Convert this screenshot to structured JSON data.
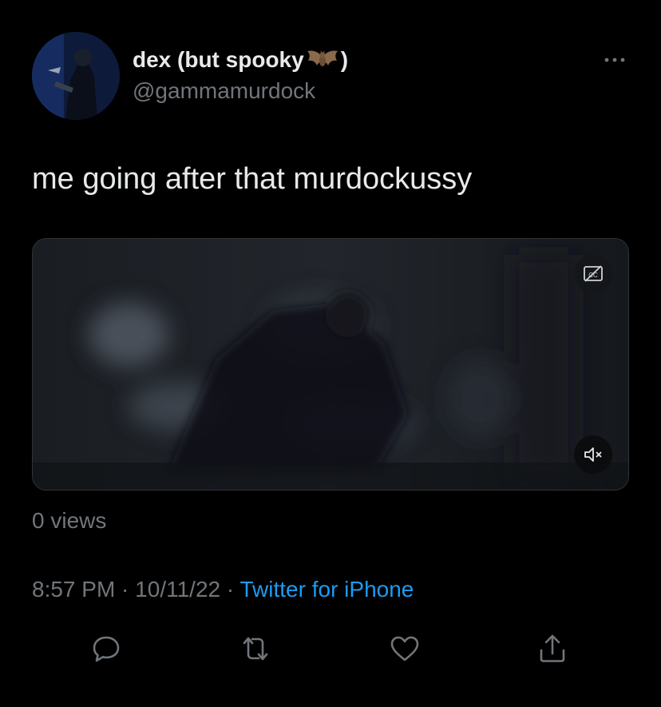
{
  "author": {
    "display_name_prefix": "dex (but spooky",
    "display_name_suffix": ")",
    "handle": "@gammamurdock",
    "avatar_icon": "avatar-image"
  },
  "tweet": {
    "text": "me going after that murdockussy"
  },
  "media": {
    "type": "video",
    "cc_icon": "closed-captions-off-icon",
    "mute_icon": "speaker-muted-icon"
  },
  "stats": {
    "views": "0 views"
  },
  "meta": {
    "time": "8:57 PM",
    "separator": " · ",
    "date": "10/11/22",
    "source": "Twitter for iPhone"
  },
  "actions": [
    {
      "name": "reply",
      "icon": "reply-icon"
    },
    {
      "name": "retweet",
      "icon": "retweet-icon"
    },
    {
      "name": "like",
      "icon": "heart-icon"
    },
    {
      "name": "share",
      "icon": "share-icon"
    }
  ],
  "colors": {
    "background": "#000000",
    "primary_text": "#e7e9ea",
    "secondary_text": "#71767b",
    "accent": "#1d9bf0"
  }
}
